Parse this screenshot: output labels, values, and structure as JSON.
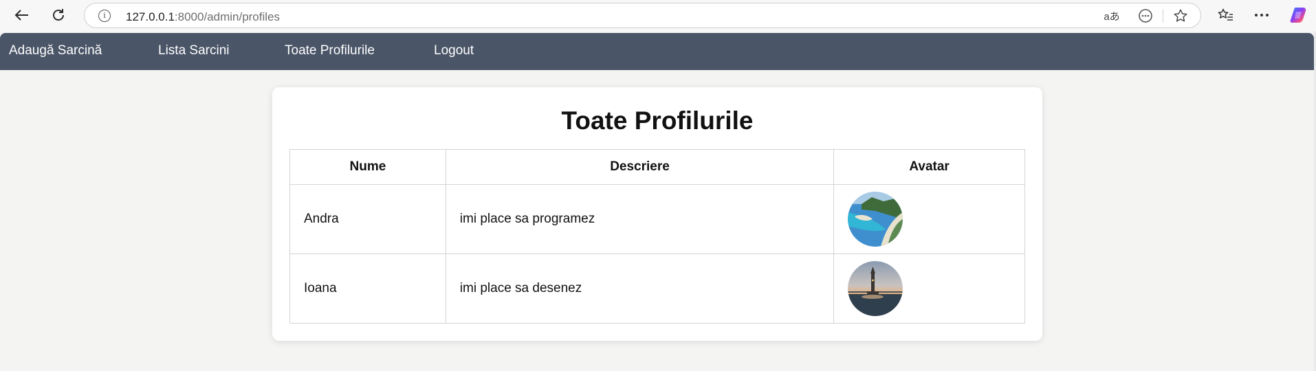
{
  "browser": {
    "url_host": "127.0.0.1",
    "url_rest": ":8000/admin/profiles",
    "translate_glyph": "aあ"
  },
  "nav": {
    "items": [
      {
        "label": "Adaugă Sarcină"
      },
      {
        "label": "Lista Sarcini"
      },
      {
        "label": "Toate Profilurile"
      },
      {
        "label": "Logout"
      }
    ],
    "bg_color": "#4a5568"
  },
  "page": {
    "title": "Toate Profilurile"
  },
  "table": {
    "headers": [
      "Nume",
      "Descriere",
      "Avatar"
    ],
    "rows": [
      {
        "name": "Andra",
        "description": "imi place sa programez",
        "avatar": "beach-lagoon-photo"
      },
      {
        "name": "Ioana",
        "description": "imi place sa desenez",
        "avatar": "tower-at-sunset-photo"
      }
    ]
  }
}
